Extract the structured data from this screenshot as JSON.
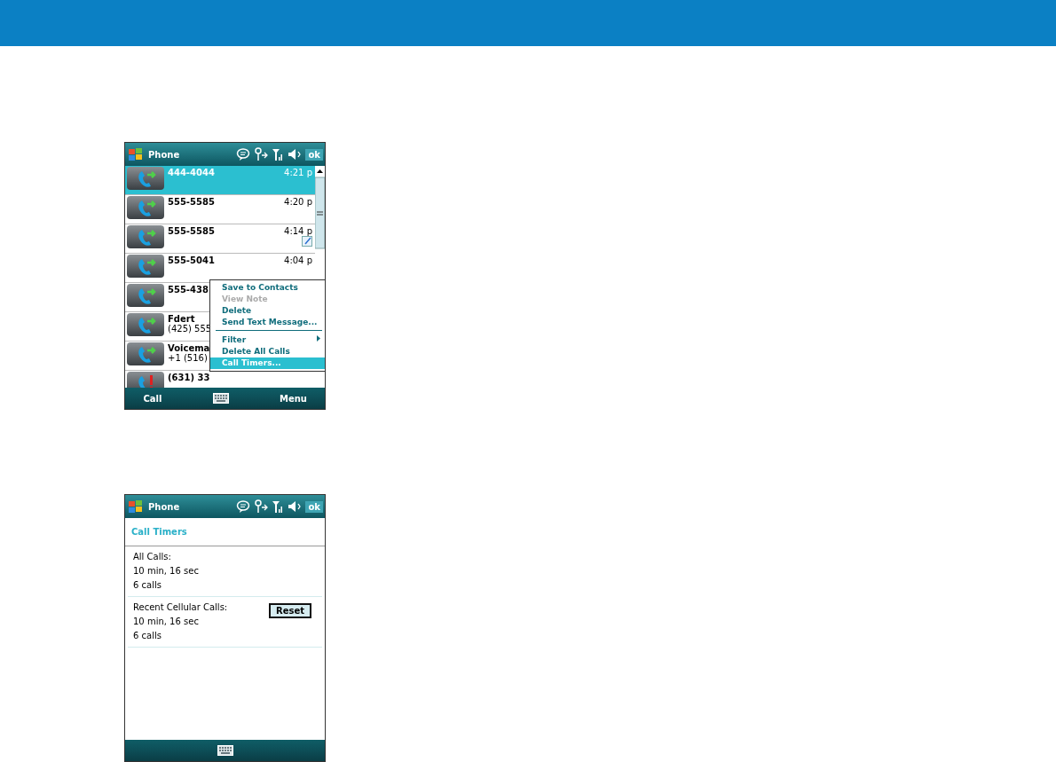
{
  "screens": [
    {
      "kind": "call_log",
      "title": "Phone",
      "ok": "ok",
      "calls": [
        {
          "kind": "outgoing",
          "name": "444-4044",
          "time": "4:21 p",
          "note": false,
          "selected": true
        },
        {
          "kind": "outgoing",
          "name": "555-5585",
          "time": "4:20 p",
          "note": false,
          "selected": false
        },
        {
          "kind": "outgoing",
          "name": "555-5585",
          "time": "4:14 p",
          "note": true,
          "selected": false
        },
        {
          "kind": "outgoing",
          "name": "555-5041",
          "time": "4:04 p",
          "note": false,
          "selected": false
        },
        {
          "kind": "outgoing",
          "name": "555-438",
          "note": false,
          "selected": false
        },
        {
          "kind": "outgoing",
          "name": "Fdert",
          "detail": "(425) 555",
          "note": false,
          "selected": false
        },
        {
          "kind": "outgoing",
          "name": "Voicema",
          "detail": "+1 (516)",
          "note": false,
          "selected": false
        },
        {
          "kind": "missed",
          "name": "(631) 33",
          "note": false,
          "selected": false
        }
      ],
      "menu": [
        {
          "label": "Save to Contacts",
          "disabled": false,
          "submenu": false,
          "separator_after": false,
          "selected": false
        },
        {
          "label": "View Note",
          "disabled": true,
          "submenu": false,
          "separator_after": false,
          "selected": false
        },
        {
          "label": "Delete",
          "disabled": false,
          "submenu": false,
          "separator_after": false,
          "selected": false
        },
        {
          "label": "Send Text Message...",
          "disabled": false,
          "submenu": false,
          "separator_after": true,
          "selected": false
        },
        {
          "label": "Filter",
          "disabled": false,
          "submenu": true,
          "separator_after": false,
          "selected": false
        },
        {
          "label": "Delete All Calls",
          "disabled": false,
          "submenu": false,
          "separator_after": false,
          "selected": false
        },
        {
          "label": "Call Timers...",
          "disabled": false,
          "submenu": false,
          "separator_after": false,
          "selected": true
        }
      ],
      "softkeys": {
        "left": "Call",
        "right": "Menu"
      }
    },
    {
      "kind": "call_timers",
      "title": "Phone",
      "ok": "ok",
      "heading": "Call Timers",
      "sections": [
        {
          "label": "All Calls:",
          "duration": "10 min, 16 sec",
          "count": "6 calls"
        },
        {
          "label": "Recent Cellular Calls:",
          "duration": "10 min, 16 sec",
          "count": "6 calls",
          "button": "Reset"
        }
      ]
    }
  ]
}
